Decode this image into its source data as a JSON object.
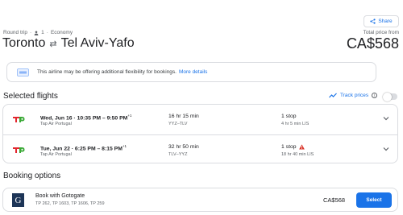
{
  "header": {
    "share_label": "Share",
    "trip_type": "Round trip",
    "passengers": "1",
    "cabin": "Economy",
    "origin": "Toronto",
    "destination": "Tel Aviv-Yafo",
    "total_label": "Total price from",
    "total_price": "CA$568"
  },
  "notice": {
    "text": "This airline may be offering additional flexibility for bookings.",
    "link": "More details"
  },
  "selected": {
    "title": "Selected flights",
    "track_label": "Track prices",
    "track_enabled": false
  },
  "flights": [
    {
      "time": "Wed, Jun 16  ·  10:35 PM – 9:50 PM",
      "day_offset": "+1",
      "airline": "Tap Air Portugal",
      "duration": "16 hr 15 min",
      "route": "YYZ–TLV",
      "stops": "1 stop",
      "warning": false,
      "layover": "4 hr 5 min LIS"
    },
    {
      "time": "Tue, Jun 22  ·  6:25 PM – 8:15 PM",
      "day_offset": "+1",
      "airline": "Tap Air Portugal",
      "duration": "32 hr 50 min",
      "route": "TLV–YYZ",
      "stops": "1 stop",
      "warning": true,
      "layover": "18 hr 40 min LIS"
    }
  ],
  "booking": {
    "title": "Booking options",
    "logo_letter": "G",
    "provider": "Book with Gotogate",
    "flight_numbers": "TP 262, TP 1603, TP 1606, TP 259",
    "price": "CA$568",
    "select_label": "Select"
  },
  "colors": {
    "accent": "#1a73e8",
    "warning": "#d93025",
    "tap_red": "#e3262e",
    "tap_green": "#39a935"
  }
}
